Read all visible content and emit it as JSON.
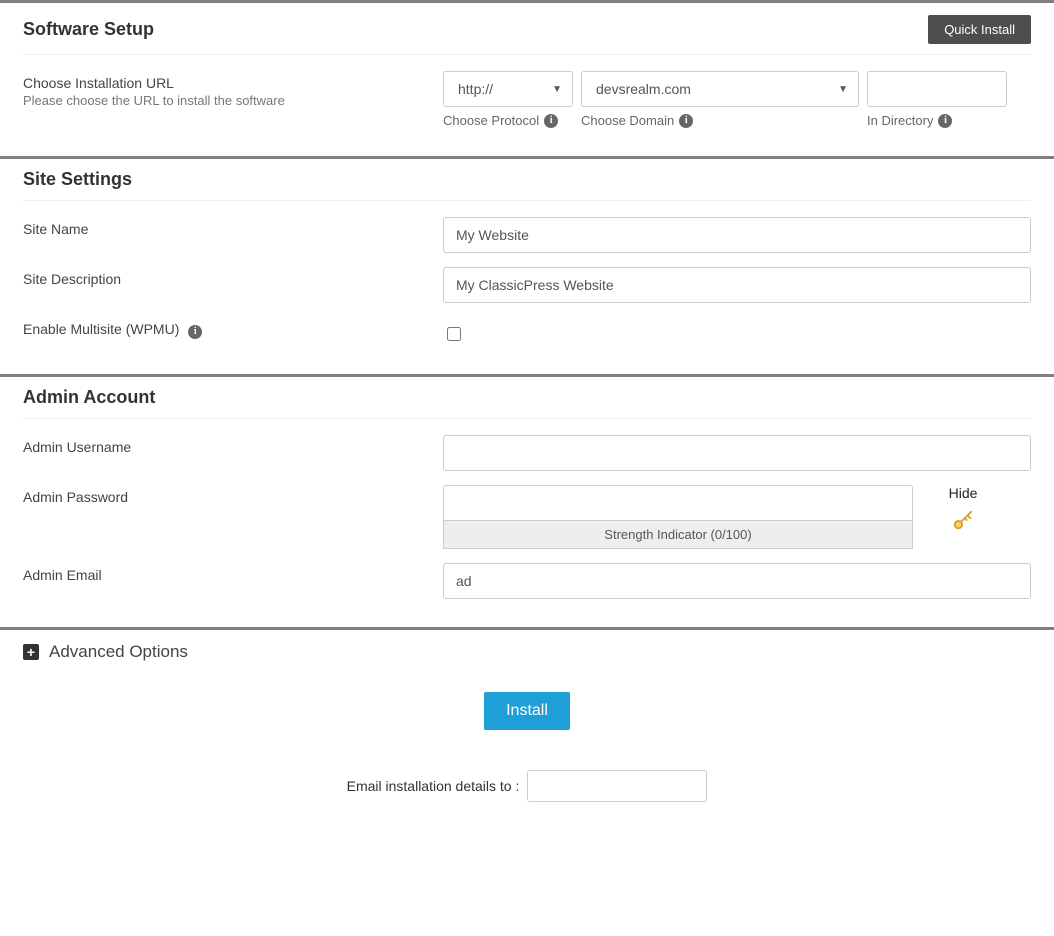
{
  "softwareSetup": {
    "title": "Software Setup",
    "quickInstall": "Quick Install",
    "chooseUrlLabel": "Choose Installation URL",
    "chooseUrlHint": "Please choose the URL to install the software",
    "protocolValue": "http://",
    "domainValue": "devsrealm.com",
    "directoryValue": "",
    "protocolLabel": "Choose Protocol",
    "domainLabel": "Choose Domain",
    "directoryLabel": "In Directory"
  },
  "siteSettings": {
    "title": "Site Settings",
    "siteNameLabel": "Site Name",
    "siteNameValue": "My Website",
    "siteDescLabel": "Site Description",
    "siteDescValue": "My ClassicPress Website",
    "multisiteLabel": "Enable Multisite (WPMU)"
  },
  "adminAccount": {
    "title": "Admin Account",
    "usernameLabel": "Admin Username",
    "usernameValue": "",
    "passwordLabel": "Admin Password",
    "passwordValue": "",
    "strengthText": "Strength Indicator (0/100)",
    "hideLabel": "Hide",
    "emailLabel": "Admin Email",
    "emailValue": "ad"
  },
  "advanced": {
    "title": "Advanced Options"
  },
  "footer": {
    "installLabel": "Install",
    "emailDetailsLabel": "Email installation details to :",
    "emailDetailsValue": ""
  }
}
